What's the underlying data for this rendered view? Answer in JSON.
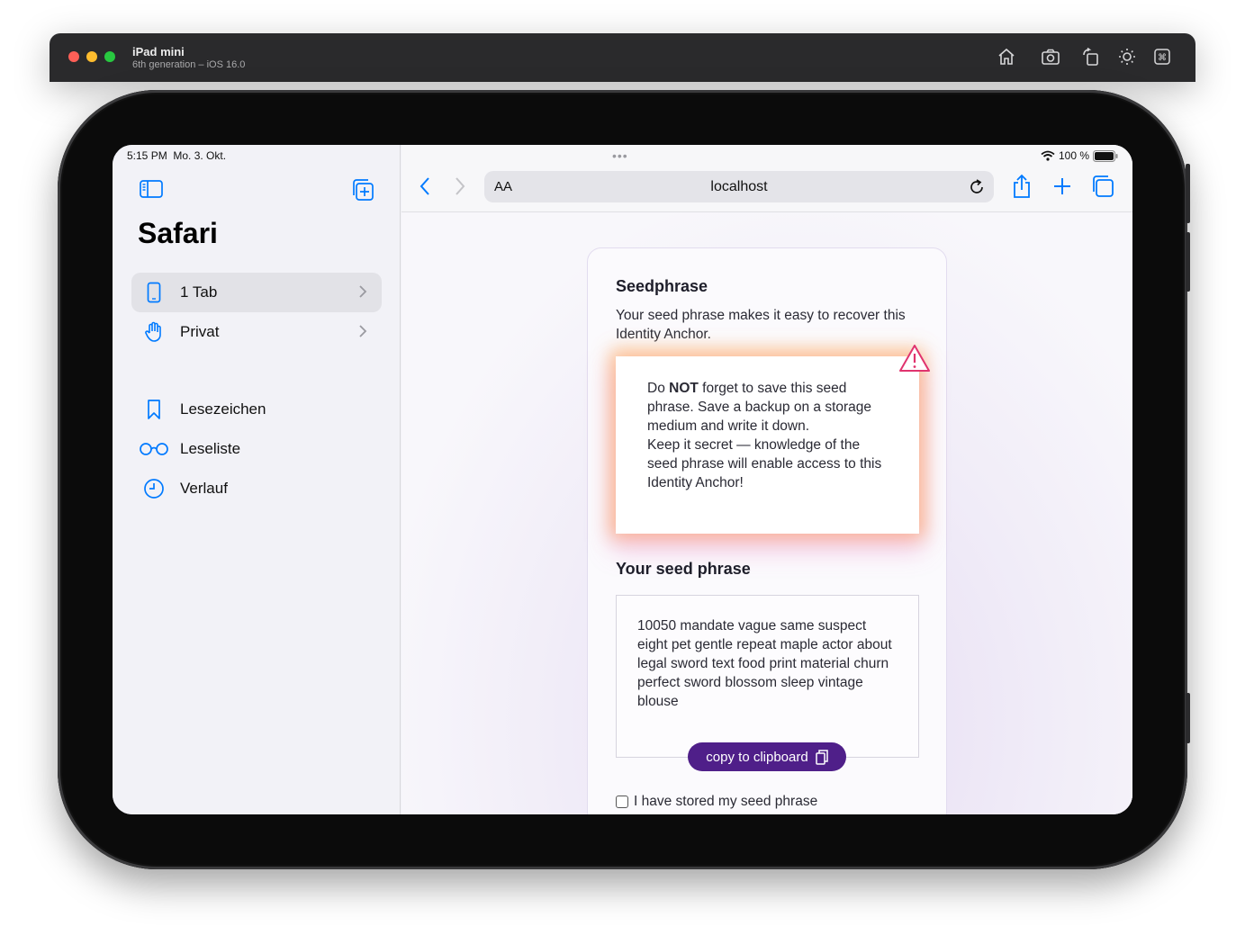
{
  "simulator": {
    "device_name": "iPad mini",
    "device_sub": "6th generation – iOS 16.0"
  },
  "status": {
    "time": "5:15 PM",
    "date": "Mo. 3. Okt.",
    "battery": "100 %"
  },
  "sidebar": {
    "title": "Safari",
    "groups": [
      {
        "label": "1 Tab",
        "icon": "ipad-icon"
      },
      {
        "label": "Privat",
        "icon": "hand-icon"
      }
    ],
    "items": [
      {
        "label": "Lesezeichen",
        "icon": "bookmark-icon"
      },
      {
        "label": "Leseliste",
        "icon": "glasses-icon"
      },
      {
        "label": "Verlauf",
        "icon": "clock-icon"
      }
    ]
  },
  "browser": {
    "aa_label": "AA",
    "url": "localhost"
  },
  "page": {
    "title": "Seedphrase",
    "description": "Your seed phrase makes it easy to recover this Identity Anchor.",
    "warning": {
      "prefix": "Do ",
      "strong": "NOT",
      "line1_rest": " forget to save this seed phrase. Save a backup on a storage medium and write it down.",
      "line2": "Keep it secret — knowledge of the seed phrase will enable access to this Identity Anchor!"
    },
    "seed_title": "Your seed phrase",
    "seed_phrase": "10050 mandate vague same suspect eight pet gentle repeat maple actor about legal sword text food print material churn perfect sword blossom sleep vintage blouse",
    "copy_label": "copy to clipboard",
    "confirm_label": "I have stored my seed phrase"
  },
  "colors": {
    "accent": "#007aff",
    "button": "#4f1f89",
    "warning_icon": "#e0336e"
  }
}
